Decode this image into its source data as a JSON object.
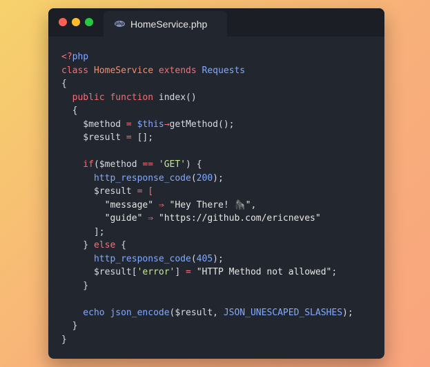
{
  "window": {
    "tab_label": "HomeService.php",
    "tab_icon": "php-icon",
    "tab_icon_text": "php"
  },
  "colors": {
    "background_start": "#f6d26b",
    "background_end": "#f9a47e",
    "editor": "#22262e",
    "titlebar": "#1b1e24",
    "close": "#ff5f57",
    "minimize": "#febc2e",
    "maximize": "#28c840"
  },
  "code": {
    "lines": [
      [
        {
          "t": "<?",
          "c": "kw"
        },
        {
          "t": "php",
          "c": "type"
        }
      ],
      [
        {
          "t": "class ",
          "c": "kw"
        },
        {
          "t": "HomeService",
          "c": "cls"
        },
        {
          "t": " extends ",
          "c": "kw"
        },
        {
          "t": "Requests",
          "c": "type"
        }
      ],
      [
        {
          "t": "{",
          "c": "punc"
        }
      ],
      [
        {
          "t": "  public ",
          "c": "kw"
        },
        {
          "t": "function ",
          "c": "kw"
        },
        {
          "t": "index",
          "c": "fn"
        },
        {
          "t": "()",
          "c": "punc"
        }
      ],
      [
        {
          "t": "  {",
          "c": "punc"
        }
      ],
      [
        {
          "t": "    $method ",
          "c": "var"
        },
        {
          "t": "= ",
          "c": "op"
        },
        {
          "t": "$this",
          "c": "this"
        },
        {
          "t": "→",
          "c": "op"
        },
        {
          "t": "getMethod",
          "c": "fn"
        },
        {
          "t": "();",
          "c": "punc"
        }
      ],
      [
        {
          "t": "    $result ",
          "c": "var"
        },
        {
          "t": "= ",
          "c": "op"
        },
        {
          "t": "[];",
          "c": "punc"
        }
      ],
      [
        {
          "t": "",
          "c": "punc"
        }
      ],
      [
        {
          "t": "    if",
          "c": "kw"
        },
        {
          "t": "($method ",
          "c": "var"
        },
        {
          "t": "== ",
          "c": "op"
        },
        {
          "t": "'GET'",
          "c": "str"
        },
        {
          "t": ") {",
          "c": "punc"
        }
      ],
      [
        {
          "t": "      http_response_code",
          "c": "builtin"
        },
        {
          "t": "(",
          "c": "punc"
        },
        {
          "t": "200",
          "c": "num"
        },
        {
          "t": ");",
          "c": "punc"
        }
      ],
      [
        {
          "t": "      $result ",
          "c": "var"
        },
        {
          "t": "= [",
          "c": "op"
        }
      ],
      [
        {
          "t": "        \"message\" ",
          "c": "key"
        },
        {
          "t": "⇒ ",
          "c": "op"
        },
        {
          "t": "\"Hey There! ",
          "c": "key"
        },
        {
          "t": "🦍",
          "c": "emoji"
        },
        {
          "t": "\",",
          "c": "key"
        }
      ],
      [
        {
          "t": "        \"guide\" ",
          "c": "key"
        },
        {
          "t": "⇒ ",
          "c": "op"
        },
        {
          "t": "\"https://github.com/ericneves\"",
          "c": "key"
        }
      ],
      [
        {
          "t": "      ];",
          "c": "punc"
        }
      ],
      [
        {
          "t": "    } ",
          "c": "punc"
        },
        {
          "t": "else",
          "c": "kw"
        },
        {
          "t": " {",
          "c": "punc"
        }
      ],
      [
        {
          "t": "      http_response_code",
          "c": "builtin"
        },
        {
          "t": "(",
          "c": "punc"
        },
        {
          "t": "405",
          "c": "num"
        },
        {
          "t": ");",
          "c": "punc"
        }
      ],
      [
        {
          "t": "      $result[",
          "c": "var"
        },
        {
          "t": "'error'",
          "c": "str"
        },
        {
          "t": "] ",
          "c": "punc"
        },
        {
          "t": "= ",
          "c": "op"
        },
        {
          "t": "\"HTTP Method not allowed\"",
          "c": "key"
        },
        {
          "t": ";",
          "c": "punc"
        }
      ],
      [
        {
          "t": "    }",
          "c": "punc"
        }
      ],
      [
        {
          "t": "",
          "c": "punc"
        }
      ],
      [
        {
          "t": "    echo ",
          "c": "builtin"
        },
        {
          "t": "json_encode",
          "c": "builtin"
        },
        {
          "t": "($result, ",
          "c": "var"
        },
        {
          "t": "JSON_UNESCAPED_SLASHES",
          "c": "const"
        },
        {
          "t": ");",
          "c": "punc"
        }
      ],
      [
        {
          "t": "  }",
          "c": "punc"
        }
      ],
      [
        {
          "t": "}",
          "c": "punc"
        }
      ]
    ]
  }
}
